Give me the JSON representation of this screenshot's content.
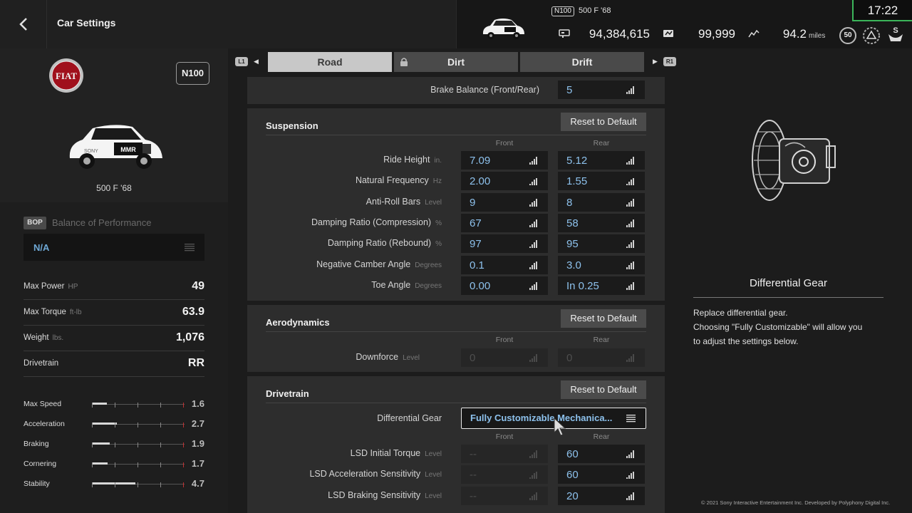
{
  "header": {
    "title": "Car Settings",
    "class_badge": "N100",
    "car_name": "500 F '68",
    "credits": "94,384,615",
    "mileage_points": "99,999",
    "distance": "94.2",
    "distance_unit": "miles",
    "level": "50",
    "clock": "17:22"
  },
  "car_panel": {
    "class_label": "N100",
    "car_name": "500 F '68",
    "bop_tag": "BOP",
    "bop_label": "Balance of Performance",
    "bop_value": "N/A",
    "specs": [
      {
        "label": "Max Power",
        "unit": "HP",
        "value": "49"
      },
      {
        "label": "Max Torque",
        "unit": "ft-lb",
        "value": "63.9"
      },
      {
        "label": "Weight",
        "unit": "lbs.",
        "value": "1,076"
      },
      {
        "label": "Drivetrain",
        "unit": "",
        "value": "RR"
      }
    ],
    "performance": [
      {
        "label": "Max Speed",
        "value": "1.6",
        "fraction": 0.16
      },
      {
        "label": "Acceleration",
        "value": "2.7",
        "fraction": 0.27
      },
      {
        "label": "Braking",
        "value": "1.9",
        "fraction": 0.19
      },
      {
        "label": "Cornering",
        "value": "1.7",
        "fraction": 0.17
      },
      {
        "label": "Stability",
        "value": "4.7",
        "fraction": 0.47
      }
    ]
  },
  "tabs": {
    "left_shoulder": "L1",
    "right_shoulder": "R1",
    "items": [
      {
        "label": "Road",
        "active": true
      },
      {
        "label": "Dirt",
        "locked": true
      },
      {
        "label": "Drift"
      }
    ]
  },
  "brakes": {
    "brake_balance_label": "Brake Balance (Front/Rear)",
    "brake_balance_value": "5"
  },
  "suspension": {
    "title": "Suspension",
    "reset_label": "Reset to Default",
    "front_header": "Front",
    "rear_header": "Rear",
    "rows": [
      {
        "label": "Ride Height",
        "unit": "in.",
        "front": "7.09",
        "rear": "5.12"
      },
      {
        "label": "Natural Frequency",
        "unit": "Hz",
        "front": "2.00",
        "rear": "1.55"
      },
      {
        "label": "Anti-Roll Bars",
        "unit": "Level",
        "front": "9",
        "rear": "8"
      },
      {
        "label": "Damping Ratio (Compression)",
        "unit": "%",
        "front": "67",
        "rear": "58"
      },
      {
        "label": "Damping Ratio (Rebound)",
        "unit": "%",
        "front": "97",
        "rear": "95"
      },
      {
        "label": "Negative Camber Angle",
        "unit": "Degrees",
        "front": "0.1",
        "rear": "3.0"
      },
      {
        "label": "Toe Angle",
        "unit": "Degrees",
        "front": "0.00",
        "rear": "In 0.25"
      }
    ]
  },
  "aerodynamics": {
    "title": "Aerodynamics",
    "reset_label": "Reset to Default",
    "front_header": "Front",
    "rear_header": "Rear",
    "downforce_label": "Downforce",
    "downforce_unit": "Level",
    "downforce_front": "0",
    "downforce_rear": "0"
  },
  "drivetrain": {
    "title": "Drivetrain",
    "reset_label": "Reset to Default",
    "diff_label": "Differential Gear",
    "diff_value": "Fully Customizable Mechanica...",
    "front_header": "Front",
    "rear_header": "Rear",
    "rows": [
      {
        "label": "LSD Initial Torque",
        "unit": "Level",
        "front": "--",
        "rear": "60"
      },
      {
        "label": "LSD Acceleration Sensitivity",
        "unit": "Level",
        "front": "--",
        "rear": "60"
      },
      {
        "label": "LSD Braking Sensitivity",
        "unit": "Level",
        "front": "--",
        "rear": "20"
      }
    ]
  },
  "detail": {
    "title": "Differential Gear",
    "desc_line1": "Replace differential gear.",
    "desc_line2": "Choosing \"Fully Customizable\" will allow you",
    "desc_line3": "to adjust the settings below."
  },
  "footer": {
    "copyright": "© 2021 Sony Interactive Entertainment Inc. Developed by Polyphony Digital Inc."
  },
  "colors": {
    "accent_value": "#8dc1ec",
    "clock_border": "#3bb55a"
  }
}
